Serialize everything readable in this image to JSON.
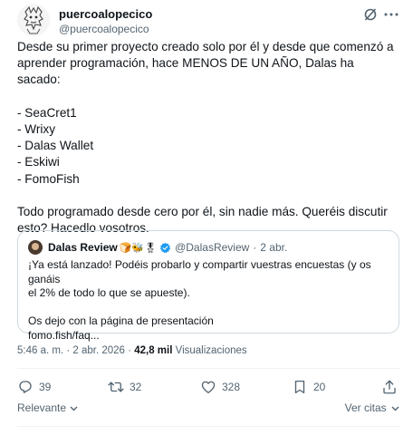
{
  "author": {
    "display_name": "puercoalopecico",
    "handle": "@puercoalopecico"
  },
  "icons": {
    "grok": "grok-icon",
    "more": "more-icon",
    "reply": "reply-icon",
    "retweet": "retweet-icon",
    "like": "heart-icon",
    "bookmark": "bookmark-icon",
    "share": "share-icon",
    "verified": "verified-badge-icon"
  },
  "tweet": {
    "lines": [
      "Desde su primer proyecto creado solo por él y desde que comenzó a",
      "aprender programación, hace MENOS DE UN AÑO, Dalas ha sacado:",
      "",
      "- SeaCret1",
      "- Wrixy",
      "- Dalas Wallet",
      "- Eskiwi",
      "- FomoFish",
      "",
      "Todo programado desde cero por él, sin nadie más. Queréis discutir",
      "esto? Hacedlo vosotros."
    ]
  },
  "quote": {
    "display_name": "Dalas Review",
    "emojis": "🍞🐝🎖",
    "handle": "@DalasReview",
    "dot": "·",
    "date": "2 abr.",
    "lines": [
      "¡Ya está lanzado! Podéis probarlo y compartir vuestras encuestas (y os ganáis",
      "el 2% de todo lo que se apueste).",
      "",
      "Os dejo con la página de presentación",
      "fomo.fish/faq..."
    ]
  },
  "meta": {
    "time": "5:46 a. m.",
    "sep": "·",
    "date": "2 abr. 2026",
    "views_count": "42,8 mil",
    "views_label": "Visualizaciones"
  },
  "actions": {
    "replies": "39",
    "retweets": "32",
    "likes": "328",
    "bookmarks": "20"
  },
  "footer": {
    "sort_label": "Relevante",
    "quotes_label": "Ver citas",
    "colors": {
      "text": "#0f1419",
      "secondary": "#536471",
      "border": "#cfd9de",
      "accent": "#1d9bf0"
    }
  }
}
